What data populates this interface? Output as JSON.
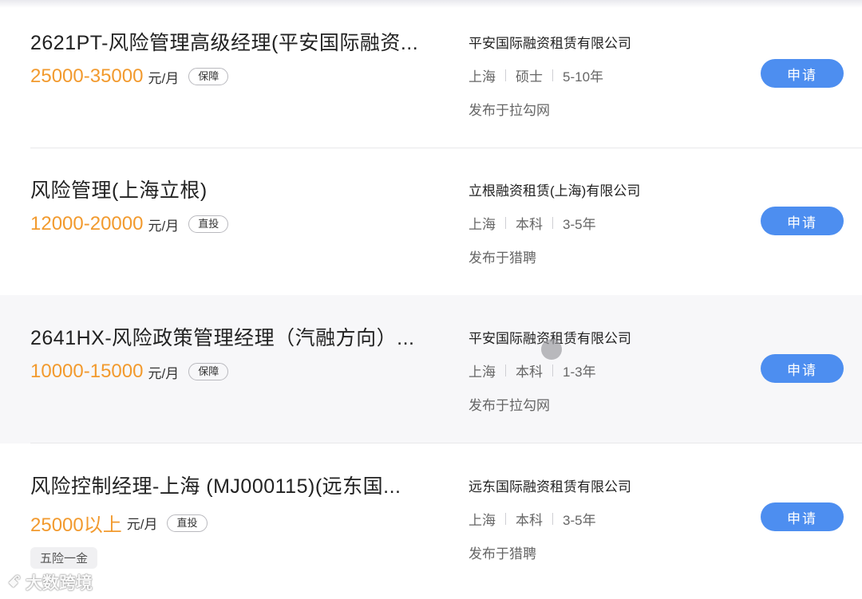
{
  "jobs": [
    {
      "title": "2621PT-风险管理高级经理(平安国际融资...",
      "salary": "25000-35000",
      "unit": "元/月",
      "tag": "保障",
      "company": "平安国际融资租赁有限公司",
      "city": "上海",
      "education": "硕士",
      "experience": "5-10年",
      "source": "发布于拉勾网",
      "apply_label": "申请"
    },
    {
      "title": "风险管理(上海立根)",
      "salary": "12000-20000",
      "unit": "元/月",
      "tag": "直投",
      "company": "立根融资租赁(上海)有限公司",
      "city": "上海",
      "education": "本科",
      "experience": "3-5年",
      "source": "发布于猎聘",
      "apply_label": "申请"
    },
    {
      "title": "2641HX-风险政策管理经理（汽融方向）...",
      "salary": "10000-15000",
      "unit": "元/月",
      "tag": "保障",
      "company": "平安国际融资租赁有限公司",
      "city": "上海",
      "education": "本科",
      "experience": "1-3年",
      "source": "发布于拉勾网",
      "apply_label": "申请"
    },
    {
      "title": "风险控制经理-上海 (MJ000115)(远东国...",
      "salary": "25000以上",
      "unit": "元/月",
      "tag": "直投",
      "extra_tag": "五险一金",
      "company": "远东国际融资租赁有限公司",
      "city": "上海",
      "education": "本科",
      "experience": "3-5年",
      "source": "发布于猎聘",
      "apply_label": "申请"
    }
  ],
  "watermark": {
    "logo": "ꗃ",
    "text": "大数跨境"
  },
  "colors": {
    "salary": "#f29a2e",
    "apply_button": "#4d8ef0"
  }
}
